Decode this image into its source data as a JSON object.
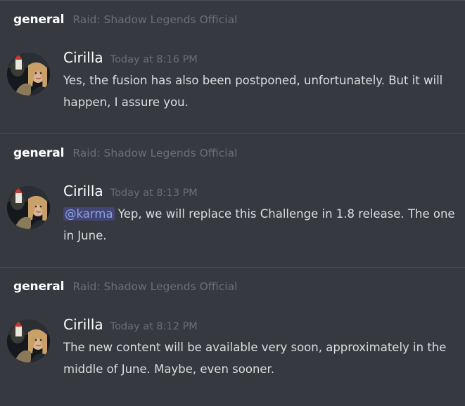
{
  "messages": [
    {
      "channel": "general",
      "guild": "Raid: Shadow Legends Official",
      "author": "Cirilla",
      "timestamp": "Today at 8:16 PM",
      "mention": "",
      "text": "Yes, the fusion has also been postponed, unfortunately. But it will happen, I assure you."
    },
    {
      "channel": "general",
      "guild": "Raid: Shadow Legends Official",
      "author": "Cirilla",
      "timestamp": "Today at 8:13 PM",
      "mention": "@karma",
      "text": " Yep, we will replace this Challenge in 1.8 release. The one in June."
    },
    {
      "channel": "general",
      "guild": "Raid: Shadow Legends Official",
      "author": "Cirilla",
      "timestamp": "Today at 8:12 PM",
      "mention": "",
      "text": "The new content will be available very soon, approximately in the middle of June. Maybe, even sooner."
    }
  ],
  "colors": {
    "background": "#36393f",
    "mention_text": "#8ea1e1",
    "mention_bg": "#414675"
  },
  "icons": {
    "avatar": "user-avatar-photo"
  }
}
